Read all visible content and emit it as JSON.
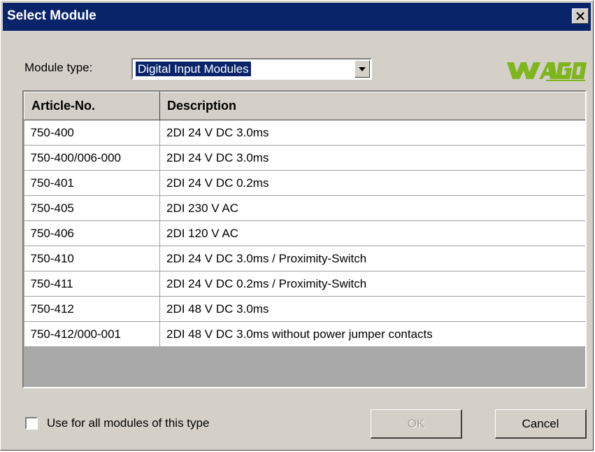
{
  "window": {
    "title": "Select Module",
    "close_icon": "close-icon"
  },
  "module_type": {
    "label": "Module type:",
    "selected": "Digital Input Modules"
  },
  "logo": {
    "text": "WAGO"
  },
  "table": {
    "headers": [
      "Article-No.",
      "Description"
    ],
    "rows": [
      [
        "750-400",
        "2DI 24 V DC 3.0ms"
      ],
      [
        "750-400/006-000",
        "2DI 24 V DC 3.0ms"
      ],
      [
        "750-401",
        "2DI 24 V DC 0.2ms"
      ],
      [
        "750-405",
        "2DI 230 V AC"
      ],
      [
        "750-406",
        "2DI 120 V AC"
      ],
      [
        "750-410",
        "2DI 24 V DC 3.0ms / Proximity-Switch"
      ],
      [
        "750-411",
        "2DI 24 V DC 0.2ms / Proximity-Switch"
      ],
      [
        "750-412",
        "2DI 48 V DC 3.0ms"
      ],
      [
        "750-412/000-001",
        "2DI 48 V DC 3.0ms without power jumper contacts"
      ]
    ]
  },
  "footer": {
    "checkbox_label": "Use for all modules of this type",
    "checkbox_checked": false,
    "ok_label": "OK",
    "cancel_label": "Cancel"
  },
  "colors": {
    "titlebar": "#0a246a",
    "face": "#d4d0c8",
    "logo_green": "#7fb51f"
  }
}
